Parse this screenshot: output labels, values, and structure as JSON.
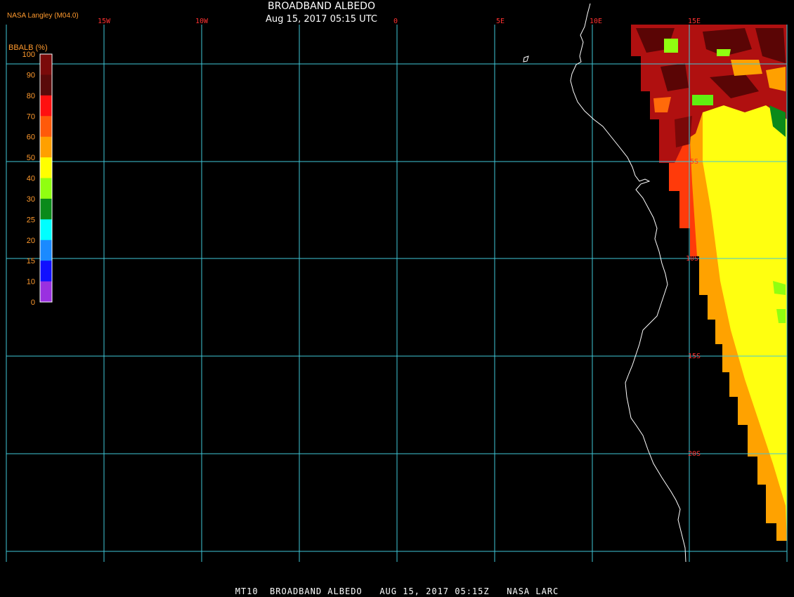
{
  "header": {
    "provider": "NASA Langley (M04.0)",
    "title": "BROADBAND ALBEDO",
    "subtitle": "Aug 15, 2017 05:15 UTC"
  },
  "legend": {
    "title": "BBALB (%)",
    "labels": [
      "100",
      "90",
      "80",
      "70",
      "60",
      "50",
      "40",
      "30",
      "25",
      "20",
      "15",
      "10",
      "0"
    ],
    "colors": [
      "#7a0a0a",
      "#5a0a0a",
      "#ff1010",
      "#ff5a0a",
      "#ffa000",
      "#ffff00",
      "#90ff10",
      "#0a8a1a",
      "#00ffff",
      "#1a8aff",
      "#1010ff",
      "#9a30e0"
    ]
  },
  "grid": {
    "lon_labels": [
      "15W",
      "10W",
      "0",
      "5E",
      "10E",
      "15E"
    ],
    "lat_labels": [
      "5S",
      "10S",
      "15S",
      "20S"
    ]
  },
  "footer": {
    "text": "MT10  BROADBAND ALBEDO   AUG 15, 2017 05:15Z   NASA LARC"
  },
  "colors": {
    "grid": "#3fc8d8",
    "coastline": "#ffffff",
    "tick_label": "#ff3030",
    "legend_text": "#ff9a2e"
  }
}
